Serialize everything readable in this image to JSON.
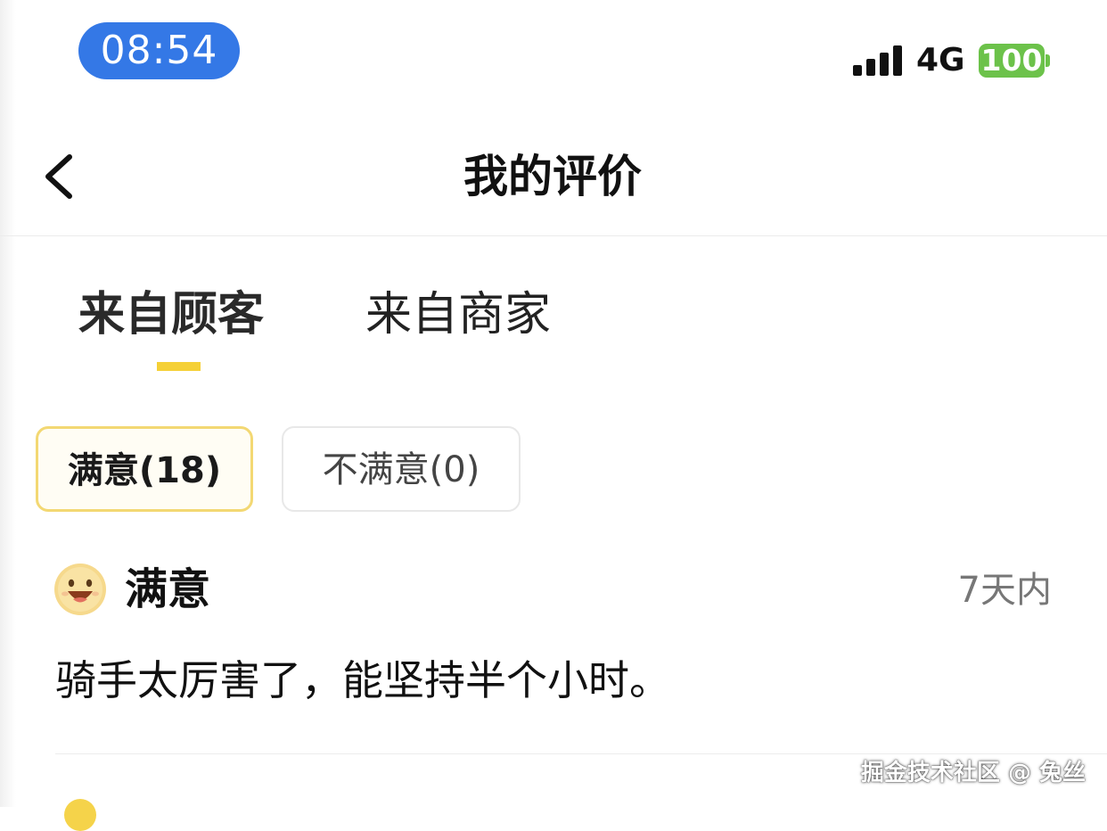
{
  "status_bar": {
    "time": "08:54",
    "network": "4G",
    "battery": "100",
    "signal_icon": "cellular-signal-icon",
    "colors": {
      "time_pill": "#3478e6",
      "battery": "#6cc24a"
    }
  },
  "nav": {
    "back_icon": "chevron-left-icon",
    "title": "我的评价"
  },
  "tabs": [
    {
      "label": "来自顾客",
      "active": true
    },
    {
      "label": "来自商家",
      "active": false
    }
  ],
  "filters": [
    {
      "label": "满意(18)",
      "selected": true
    },
    {
      "label": "不满意(0)",
      "selected": false
    }
  ],
  "reviews": [
    {
      "icon": "smiling-face-icon",
      "rating_label": "满意",
      "time": "7天内",
      "text": "骑手太厉害了，能坚持半个小时。"
    }
  ],
  "watermark": "掘金技术社区 @ 兔丝",
  "theme": {
    "accent_yellow": "#f5d036",
    "chip_border_selected": "#f3d873"
  }
}
